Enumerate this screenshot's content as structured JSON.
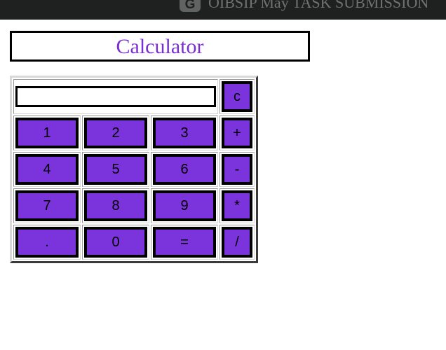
{
  "browser": {
    "tab_icon_letter": "G",
    "tab_title": "OIBSIP May TASK SUBMISSION"
  },
  "page": {
    "heading": "Calculator"
  },
  "calculator": {
    "display_value": "",
    "clear_label": "c",
    "rows": [
      [
        "1",
        "2",
        "3",
        "+"
      ],
      [
        "4",
        "5",
        "6",
        "-"
      ],
      [
        "7",
        "8",
        "9",
        "*"
      ],
      [
        ".",
        "0",
        "=",
        "/"
      ]
    ]
  },
  "colors": {
    "accent": "#7b33db",
    "heading_text": "#7a2fd4",
    "topbar": "#1f2120"
  }
}
